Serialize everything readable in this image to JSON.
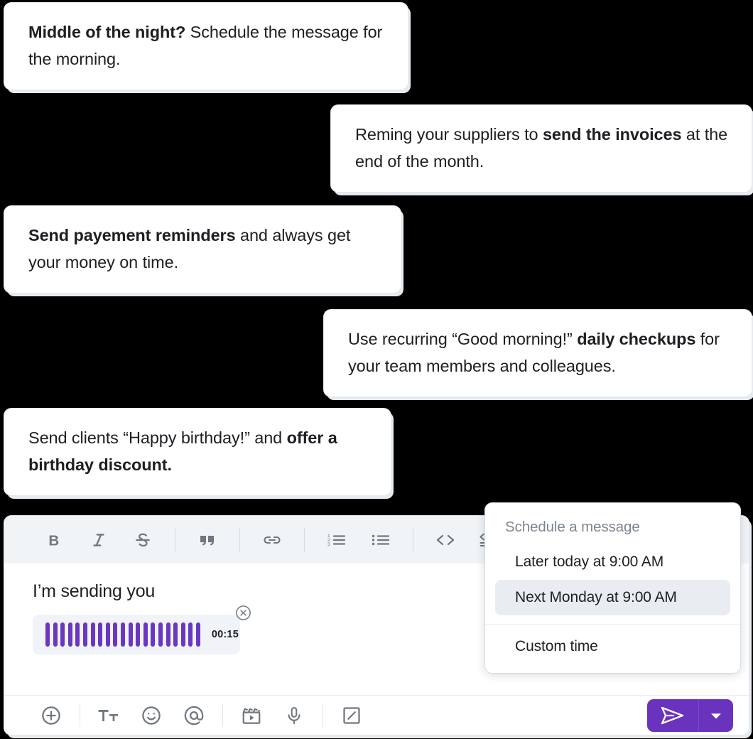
{
  "messages": [
    {
      "id": "bubble-schedule-night",
      "side": "left",
      "bold_lead": "Middle of the night?",
      "rest": " Schedule the message for the morning.",
      "bold_tail": ""
    },
    {
      "id": "bubble-invoices",
      "side": "right",
      "lead": "Reming your suppliers to ",
      "bold_mid": "send the invoices",
      "tail": " at the end of the month."
    },
    {
      "id": "bubble-payment",
      "side": "left",
      "bold_lead": "Send payement reminders",
      "rest": " and always get your money on time.",
      "bold_tail": ""
    },
    {
      "id": "bubble-checkups",
      "side": "right",
      "lead": "Use recurring “Good morning!” ",
      "bold_mid": "daily checkups",
      "tail": " for your team members and colleagues."
    },
    {
      "id": "bubble-birthday",
      "side": "left",
      "lead": "Send clients “Happy birthday!” and ",
      "bold_mid": "offer a birthday discount.",
      "tail": ""
    }
  ],
  "composer": {
    "format_toolbar": {
      "items": [
        {
          "name": "bold-icon",
          "label": "B"
        },
        {
          "name": "italic-icon",
          "label": "I"
        },
        {
          "name": "strikethrough-icon",
          "label": "S"
        },
        {
          "name": "blockquote-icon",
          "label": "””"
        },
        {
          "name": "link-icon",
          "label": "link"
        },
        {
          "name": "ordered-list-icon",
          "label": "1 2 3"
        },
        {
          "name": "bullet-list-icon",
          "label": "bullets"
        },
        {
          "name": "inline-code-icon",
          "label": "< >"
        },
        {
          "name": "code-block-icon",
          "label": "code block"
        }
      ]
    },
    "editor": {
      "text": "I’m sending you",
      "voice_note": {
        "duration": "00:15",
        "bars": 21,
        "waveform_color": "#6a37c0",
        "remove_label": "×"
      }
    },
    "bottom_toolbar": {
      "items": [
        {
          "name": "add-attachment-icon",
          "label": "+"
        },
        {
          "name": "text-format-icon",
          "label": "Tt"
        },
        {
          "name": "emoji-icon",
          "label": "☺"
        },
        {
          "name": "mention-icon",
          "label": "@"
        },
        {
          "name": "video-clip-icon",
          "label": "clip"
        },
        {
          "name": "microphone-icon",
          "label": "mic"
        },
        {
          "name": "snippet-icon",
          "label": "snippet"
        }
      ]
    },
    "send": {
      "button_label": "Send",
      "caret_label": "▾",
      "accent_color": "#6a33bd"
    }
  },
  "schedule_menu": {
    "title": "Schedule a message",
    "options": [
      {
        "label": "Later today at 9:00 AM",
        "selected": false
      },
      {
        "label": "Next Monday at 9:00 AM",
        "selected": true
      }
    ],
    "custom": {
      "label": "Custom time"
    }
  }
}
